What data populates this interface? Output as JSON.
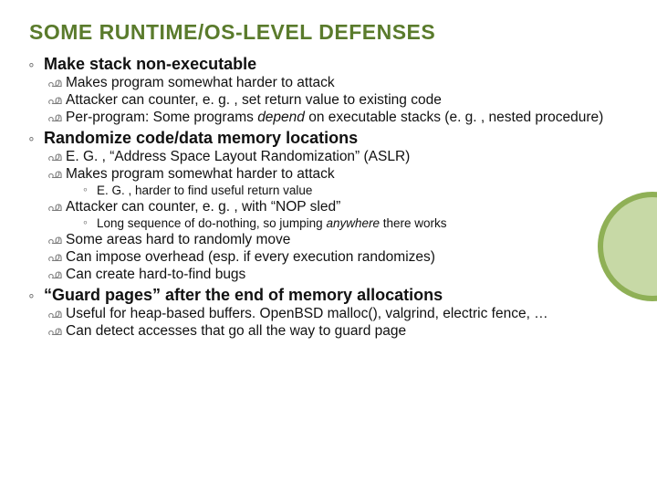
{
  "title": "SOME RUNTIME/OS-LEVEL DEFENSES",
  "bullets": {
    "glyph1": "∘",
    "glyph2": "൶",
    "glyph3": "∘"
  },
  "s1": {
    "head": "Make stack non-executable",
    "a": "Makes program somewhat harder to attack",
    "b": "Attacker can counter, e. g. , set return value to existing code",
    "c_pre": "Per-program: Some programs ",
    "c_em": "depend",
    "c_post": " on executable stacks (e. g. , nested procedure)"
  },
  "s2": {
    "head": "Randomize code/data memory locations",
    "a": "E. G. , “Address Space Layout Randomization” (ASLR)",
    "b": "Makes program somewhat harder to attack",
    "b1": "E. G. , harder to find useful return value",
    "c": "Attacker can counter, e. g. , with “NOP sled”",
    "c1_pre": "Long sequence of do-nothing, so jumping ",
    "c1_em": "anywhere",
    "c1_post": " there works",
    "d": "Some areas hard to randomly move",
    "e": "Can impose overhead (esp. if every execution randomizes)",
    "f": "Can create hard-to-find bugs"
  },
  "s3": {
    "head": "“Guard pages” after the end of memory allocations",
    "a": "Useful for heap-based buffers. OpenBSD malloc(), valgrind, electric fence, …",
    "b": "Can detect accesses that go all the way to guard page"
  }
}
